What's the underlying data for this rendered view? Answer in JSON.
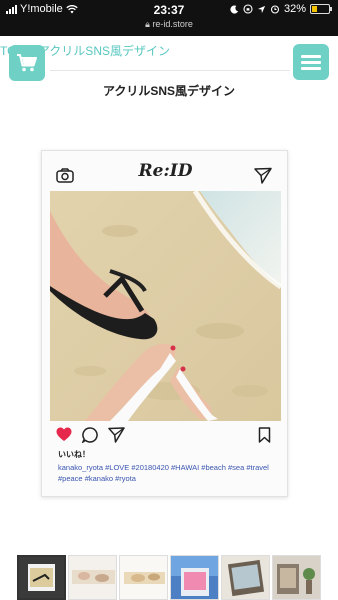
{
  "status_bar": {
    "carrier": "Y!mobile",
    "time": "23:37",
    "url": "re-id.store",
    "battery": "32%",
    "battery_level": 0.32
  },
  "header": {
    "breadcrumb": "TOP > アクリルSNS風デザイン",
    "cart_icon": "cart-icon",
    "menu_icon": "hamburger-menu-icon"
  },
  "page": {
    "title": "アクリルSNS風デザイン"
  },
  "card": {
    "logo": "Re:ID",
    "likes": "いいね！",
    "caption": "kanako_ryota #LOVE #20180420 #HAWAI #beach #sea #travel #peace #kanako #ryota",
    "icons": [
      "camera-icon",
      "send-icon",
      "heart-icon",
      "comment-icon",
      "share-icon",
      "bookmark-icon"
    ],
    "heart_color": "#e5284b"
  },
  "thumbnails": {
    "count": 6,
    "selected": 1
  },
  "colors": {
    "accent": "#6fd0c6",
    "link": "#58c7c0",
    "hashtag": "#3a55b0"
  }
}
